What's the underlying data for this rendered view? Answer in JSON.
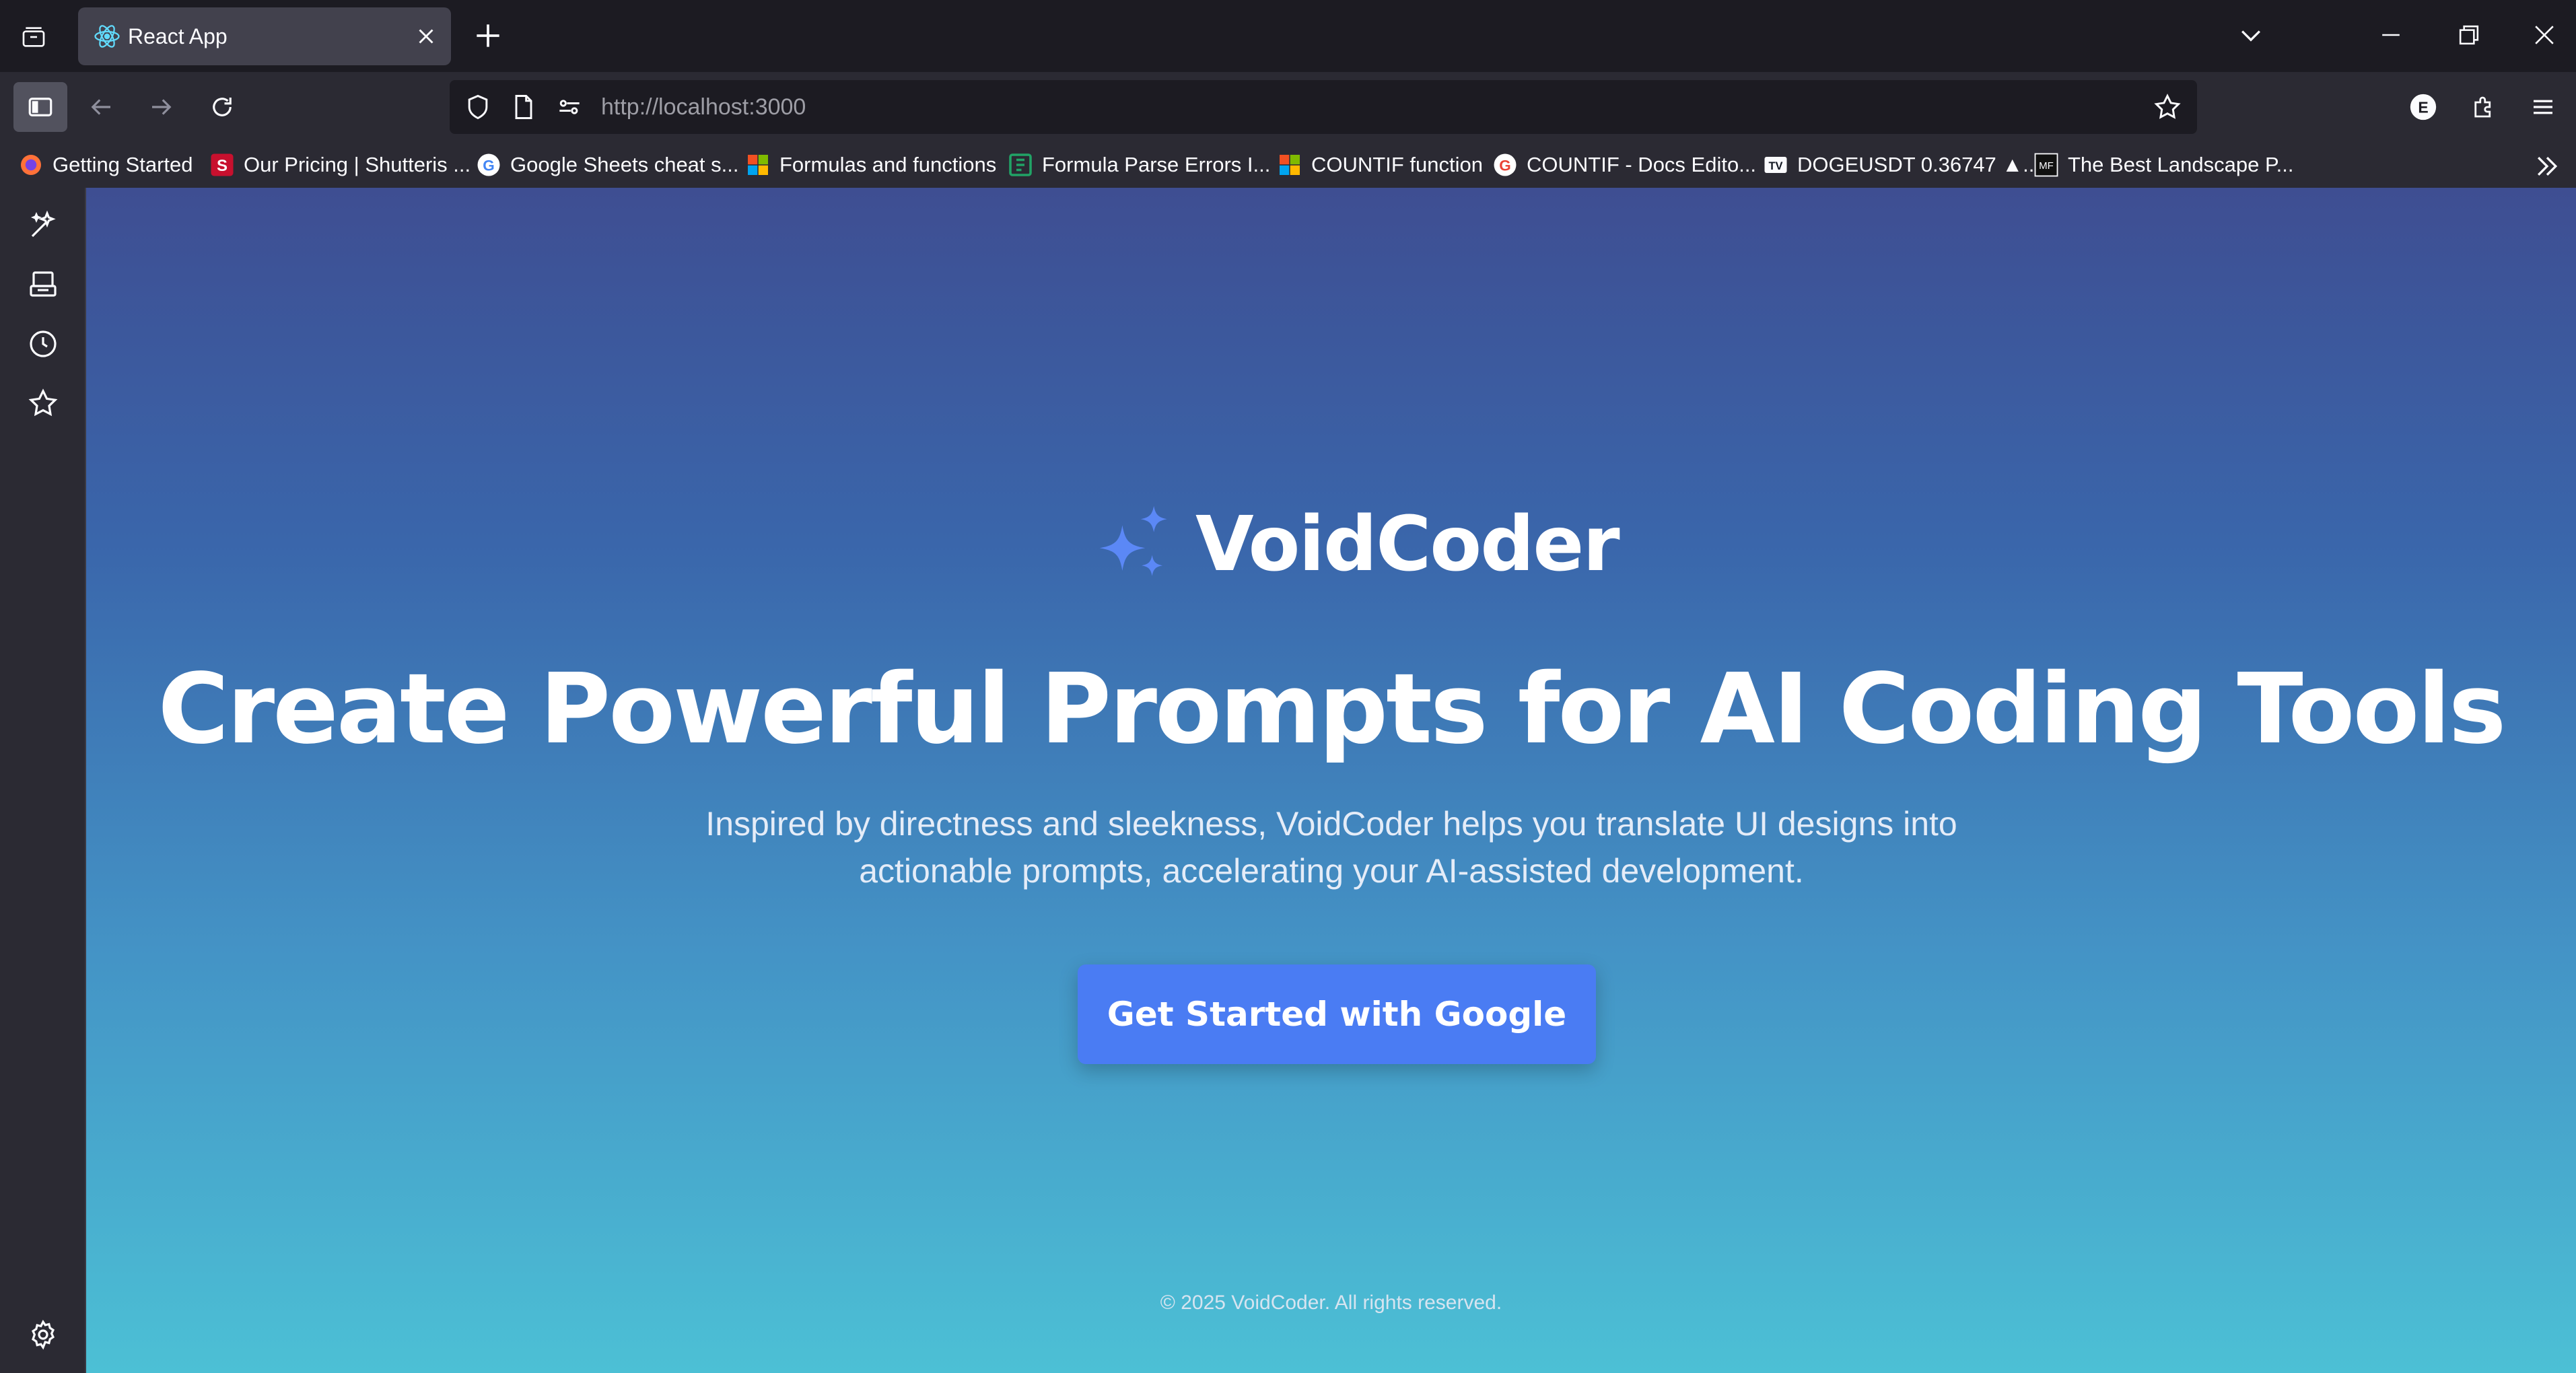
{
  "browser": {
    "tab": {
      "title": "React App"
    },
    "url": {
      "host": "http://localhost",
      "port": ":3000"
    },
    "account_initial": "E"
  },
  "bookmarks": [
    {
      "label": "Getting Started",
      "icon": "firefox-icon"
    },
    {
      "label": "Our Pricing | Shutteris ...",
      "icon": "shutterstock-icon"
    },
    {
      "label": "Google Sheets cheat s...",
      "icon": "google-icon"
    },
    {
      "label": "Formulas and functions",
      "icon": "microsoft-icon"
    },
    {
      "label": "Formula Parse Errors I...",
      "icon": "sheet-icon"
    },
    {
      "label": "COUNTIF function",
      "icon": "microsoft-icon"
    },
    {
      "label": "COUNTIF - Docs Edito...",
      "icon": "google-icon"
    },
    {
      "label": "DOGEUSDT 0.36747 ▲...",
      "icon": "tradingview-icon"
    },
    {
      "label": "The Best Landscape P...",
      "icon": "mf-icon"
    }
  ],
  "hero": {
    "brand_name": "VoidCoder",
    "headline": "Create Powerful Prompts for AI Coding Tools",
    "subline_1": "Inspired by directness and sleekness, VoidCoder helps you translate UI designs into",
    "subline_2": "actionable prompts, accelerating your AI-assisted development.",
    "cta_label": "Get Started with Google",
    "footer": "© 2025 VoidCoder. All rights reserved."
  },
  "colors": {
    "accent": "#4a7cf3",
    "gradient_top": "#3e4e92",
    "gradient_bottom": "#4cc0d5",
    "chrome_dark": "#1c1b22",
    "chrome": "#2b2a33"
  }
}
